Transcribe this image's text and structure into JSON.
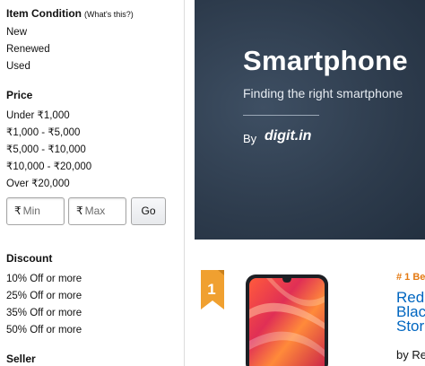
{
  "filters": {
    "item_condition": {
      "title": "Item Condition",
      "whats_this": "(What's this?)",
      "options": [
        "New",
        "Renewed",
        "Used"
      ]
    },
    "price": {
      "title": "Price",
      "options": [
        "Under ₹1,000",
        "₹1,000 - ₹5,000",
        "₹5,000 - ₹10,000",
        "₹10,000 - ₹20,000",
        "Over ₹20,000"
      ],
      "currency_symbol": "₹",
      "min_placeholder": "Min",
      "max_placeholder": "Max",
      "go_label": "Go"
    },
    "discount": {
      "title": "Discount",
      "options": [
        "10% Off or more",
        "25% Off or more",
        "35% Off or more",
        "50% Off or more"
      ]
    },
    "seller": {
      "title": "Seller"
    }
  },
  "banner": {
    "title": "Smartphone",
    "subtitle": "Finding the right smartphone",
    "by_label": "By",
    "brand": "digit.in"
  },
  "product": {
    "rank_badge": "1",
    "rank_text": "# 1 Be",
    "title_lines": [
      "Red",
      "Blac",
      "Stor"
    ],
    "by_line": "by Re",
    "badge_color": "#f0a030",
    "link_color": "#0066c0",
    "rank_color": "#e47911"
  }
}
